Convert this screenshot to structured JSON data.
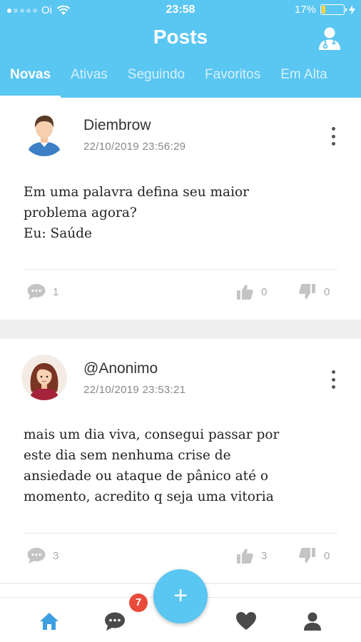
{
  "status_bar": {
    "carrier": "Oi",
    "time": "23:58",
    "battery_percent": "17%",
    "battery_level": 0.17
  },
  "header": {
    "title": "Posts",
    "profile_icon": "doctor-profile-icon"
  },
  "tabs": [
    {
      "label": "Novas",
      "active": true
    },
    {
      "label": "Ativas",
      "active": false
    },
    {
      "label": "Seguindo",
      "active": false
    },
    {
      "label": "Favoritos",
      "active": false
    },
    {
      "label": "Em Alta",
      "active": false
    }
  ],
  "posts": [
    {
      "author": "Diembrow",
      "date": "22/10/2019 23:56:29",
      "content": "Em uma palavra defina seu maior\nproblema agora?\nEu: Saúde",
      "comments": "1",
      "likes": "0",
      "dislikes": "0"
    },
    {
      "author": "@Anonimo",
      "date": "22/10/2019 23:53:21",
      "content": "mais um dia viva, consegui passar por\neste dia sem nenhuma crise de\nansiedade ou ataque de pânico até o\nmomento, acredito q seja uma vitoria",
      "comments": "3",
      "likes": "3",
      "dislikes": "0"
    }
  ],
  "bottom_nav": {
    "items": [
      "home-icon",
      "chat-icon",
      "heart-icon",
      "user-icon"
    ],
    "chat_badge": "7",
    "fab_label": "+"
  },
  "colors": {
    "primary": "#5ac6f2",
    "badge": "#e84a3c",
    "active_nav": "#3d9ee0",
    "inactive_nav": "#4a4a4a"
  }
}
